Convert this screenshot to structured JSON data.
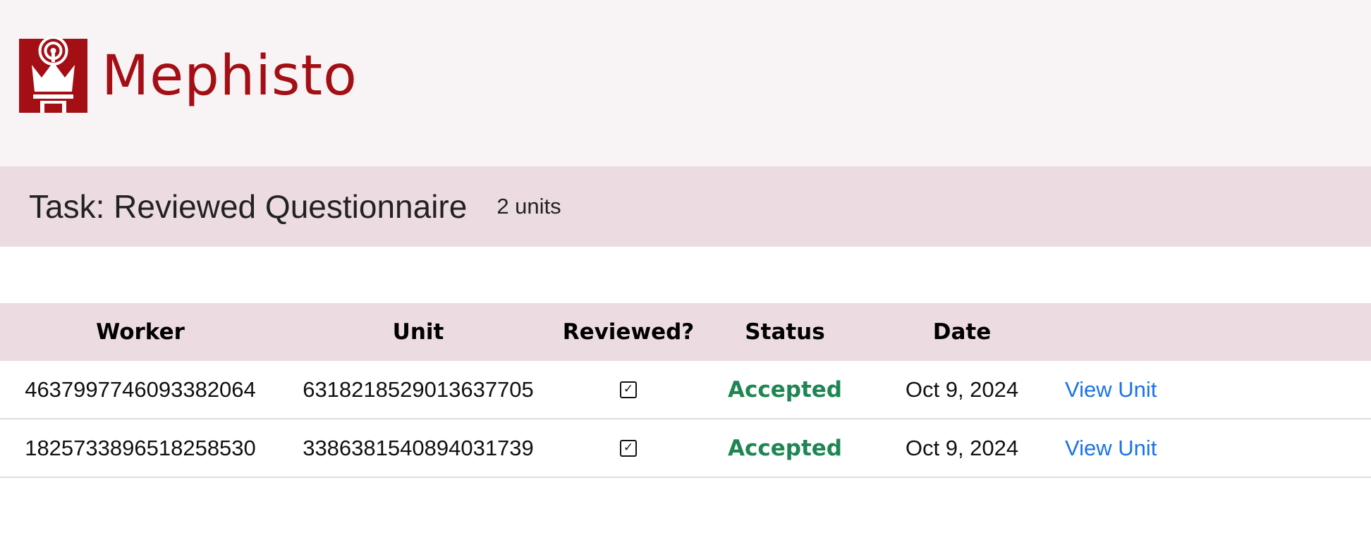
{
  "app": {
    "name": "Mephisto",
    "logo_icon": "crown-broadcast-icon",
    "brand_color": "#a30f14"
  },
  "task": {
    "title": "Task: Reviewed Questionnaire",
    "unit_count": "2 units"
  },
  "table": {
    "headers": {
      "worker": "Worker",
      "unit": "Unit",
      "reviewed": "Reviewed?",
      "status": "Status",
      "date": "Date"
    },
    "rows": [
      {
        "worker": "4637997746093382064",
        "unit": "6318218529013637705",
        "reviewed": "☑",
        "status": "Accepted",
        "date": "Oct 9, 2024",
        "link": "View Unit"
      },
      {
        "worker": "1825733896518258530",
        "unit": "3386381540894031739",
        "reviewed": "☑",
        "status": "Accepted",
        "date": "Oct 9, 2024",
        "link": "View Unit"
      }
    ]
  },
  "colors": {
    "header_bg": "#f8f3f4",
    "band_bg": "#ecdbe0",
    "accepted": "#1e8652",
    "link": "#1a73e8"
  }
}
